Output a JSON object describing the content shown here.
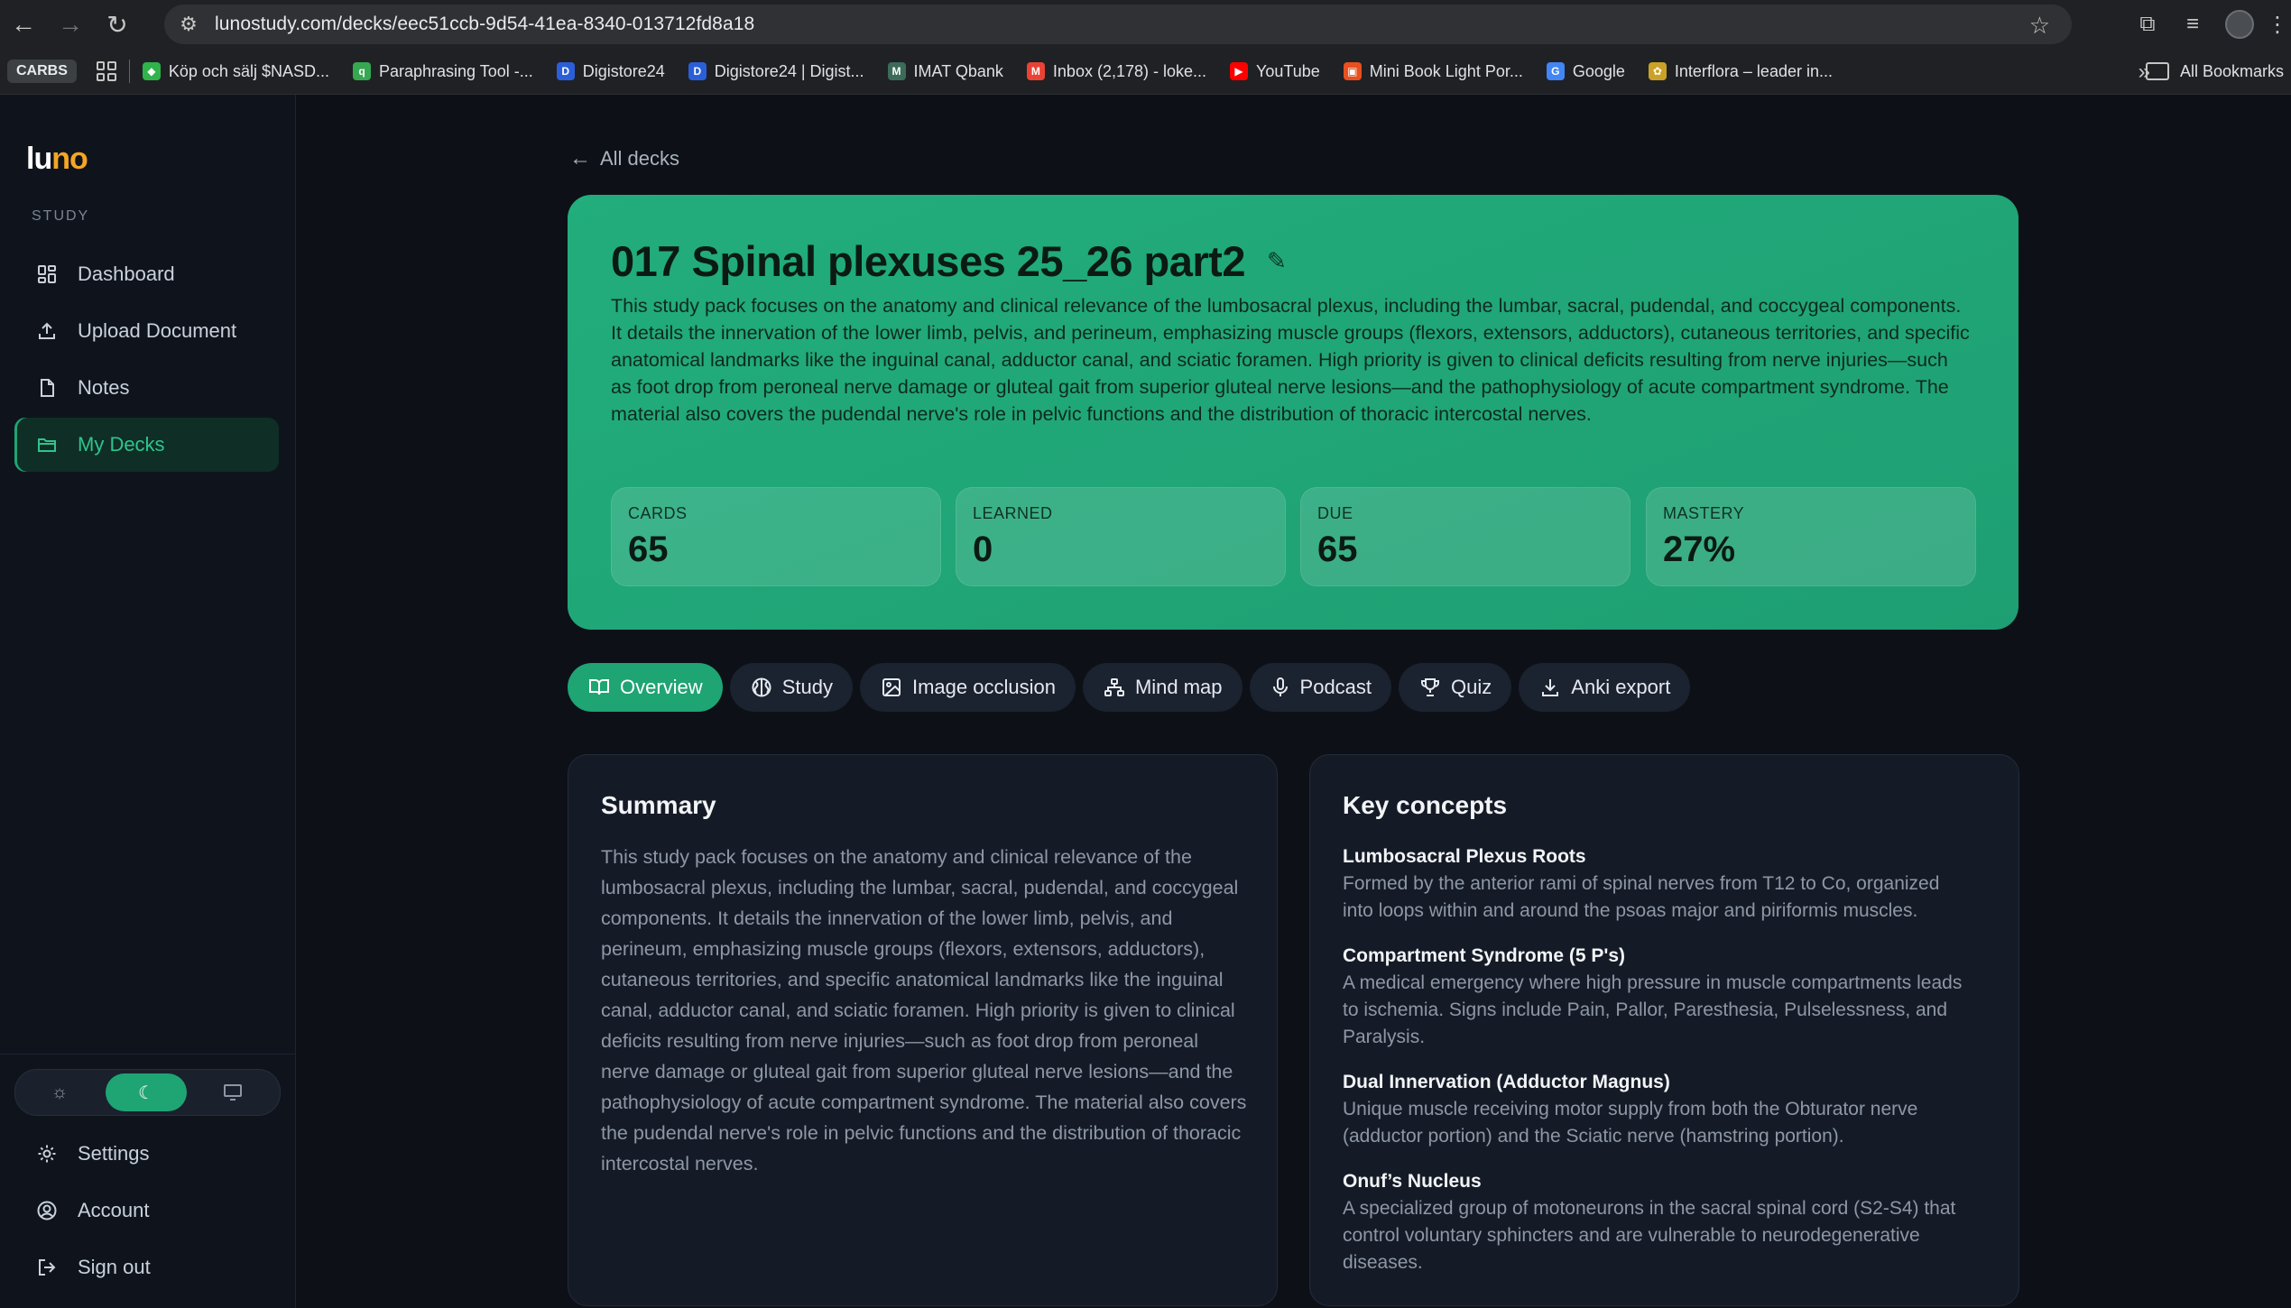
{
  "browser": {
    "url": "lunostudy.com/decks/eec51ccb-9d54-41ea-8340-013712fd8a18",
    "bookmarks": [
      {
        "label": "Köp och sälj $NASD...",
        "icon": "trading-icon",
        "color": "#2fb34a"
      },
      {
        "label": "Paraphrasing Tool -...",
        "icon": "quillbot-icon",
        "color": "#36a852"
      },
      {
        "label": "Digistore24",
        "icon": "digistore-icon",
        "color": "#2b5fd9"
      },
      {
        "label": "Digistore24 | Digist...",
        "icon": "digistore-icon",
        "color": "#2b5fd9"
      },
      {
        "label": "IMAT Qbank",
        "icon": "imat-icon",
        "color": "#3c6b5a"
      },
      {
        "label": "Inbox (2,178) - loke...",
        "icon": "gmail-icon",
        "color": "#ea4335"
      },
      {
        "label": "YouTube",
        "icon": "youtube-icon",
        "color": "#ff0000"
      },
      {
        "label": "Mini Book Light Por...",
        "icon": "shop-icon",
        "color": "#e8501f"
      },
      {
        "label": "Google",
        "icon": "google-icon",
        "color": "#4285f4"
      },
      {
        "label": "Interflora – leader in...",
        "icon": "interflora-icon",
        "color": "#c9a227"
      }
    ],
    "carbs_label": "CARBS",
    "all_bookmarks": "All Bookmarks"
  },
  "sidebar": {
    "logo_a": "lu",
    "logo_b": "no",
    "section": "STUDY",
    "items": [
      {
        "label": "Dashboard",
        "icon": "dashboard-icon"
      },
      {
        "label": "Upload Document",
        "icon": "upload-icon"
      },
      {
        "label": "Notes",
        "icon": "notes-icon"
      },
      {
        "label": "My Decks",
        "icon": "folder-icon",
        "active": true
      }
    ],
    "theme": {
      "selected": "dark"
    },
    "bottom": [
      {
        "label": "Settings",
        "icon": "gear-icon"
      },
      {
        "label": "Account",
        "icon": "account-icon"
      },
      {
        "label": "Sign out",
        "icon": "sign-out-icon"
      }
    ]
  },
  "main": {
    "back_label": "All decks",
    "deck": {
      "title": "017 Spinal plexuses 25_26 part2",
      "description": "This study pack focuses on the anatomy and clinical relevance of the lumbosacral plexus, including the lumbar, sacral, pudendal, and coccygeal components. It details the innervation of the lower limb, pelvis, and perineum, emphasizing muscle groups (flexors, extensors, adductors), cutaneous territories, and specific anatomical landmarks like the inguinal canal, adductor canal, and sciatic foramen. High priority is given to clinical deficits resulting from nerve injuries—such as foot drop from peroneal nerve damage or gluteal gait from superior gluteal nerve lesions—and the pathophysiology of acute compartment syndrome. The material also covers the pudendal nerve's role in pelvic functions and the distribution of thoracic intercostal nerves."
    },
    "stats": [
      {
        "label": "CARDS",
        "value": "65"
      },
      {
        "label": "LEARNED",
        "value": "0"
      },
      {
        "label": "DUE",
        "value": "65"
      },
      {
        "label": "MASTERY",
        "value": "27%"
      }
    ],
    "tabs": [
      {
        "label": "Overview",
        "icon": "book-icon",
        "active": true
      },
      {
        "label": "Study",
        "icon": "brain-icon"
      },
      {
        "label": "Image occlusion",
        "icon": "image-icon"
      },
      {
        "label": "Mind map",
        "icon": "mindmap-icon"
      },
      {
        "label": "Podcast",
        "icon": "microphone-icon"
      },
      {
        "label": "Quiz",
        "icon": "trophy-icon"
      },
      {
        "label": "Anki export",
        "icon": "download-icon"
      }
    ],
    "summary": {
      "heading": "Summary",
      "text": "This study pack focuses on the anatomy and clinical relevance of the lumbosacral plexus, including the lumbar, sacral, pudendal, and coccygeal components. It details the innervation of the lower limb, pelvis, and perineum, emphasizing muscle groups (flexors, extensors, adductors), cutaneous territories, and specific anatomical landmarks like the inguinal canal, adductor canal, and sciatic foramen. High priority is given to clinical deficits resulting from nerve injuries—such as foot drop from peroneal nerve damage or gluteal gait from superior gluteal nerve lesions—and the pathophysiology of acute compartment syndrome. The material also covers the pudendal nerve's role in pelvic functions and the distribution of thoracic intercostal nerves."
    },
    "key_concepts": {
      "heading": "Key concepts",
      "items": [
        {
          "title": "Lumbosacral Plexus Roots",
          "desc": "Formed by the anterior rami of spinal nerves from T12 to Co, organized into loops within and around the psoas major and piriformis muscles."
        },
        {
          "title": "Compartment Syndrome (5 P's)",
          "desc": "A medical emergency where high pressure in muscle compartments leads to ischemia. Signs include Pain, Pallor, Paresthesia, Pulselessness, and Paralysis."
        },
        {
          "title": "Dual Innervation (Adductor Magnus)",
          "desc": "Unique muscle receiving motor supply from both the Obturator nerve (adductor portion) and the Sciatic nerve (hamstring portion)."
        },
        {
          "title": "Onuf’s Nucleus",
          "desc": "A specialized group of motoneurons in the sacral spinal cord (S2-S4) that control voluntary sphincters and are vulnerable to neurodegenerative diseases."
        }
      ]
    }
  }
}
